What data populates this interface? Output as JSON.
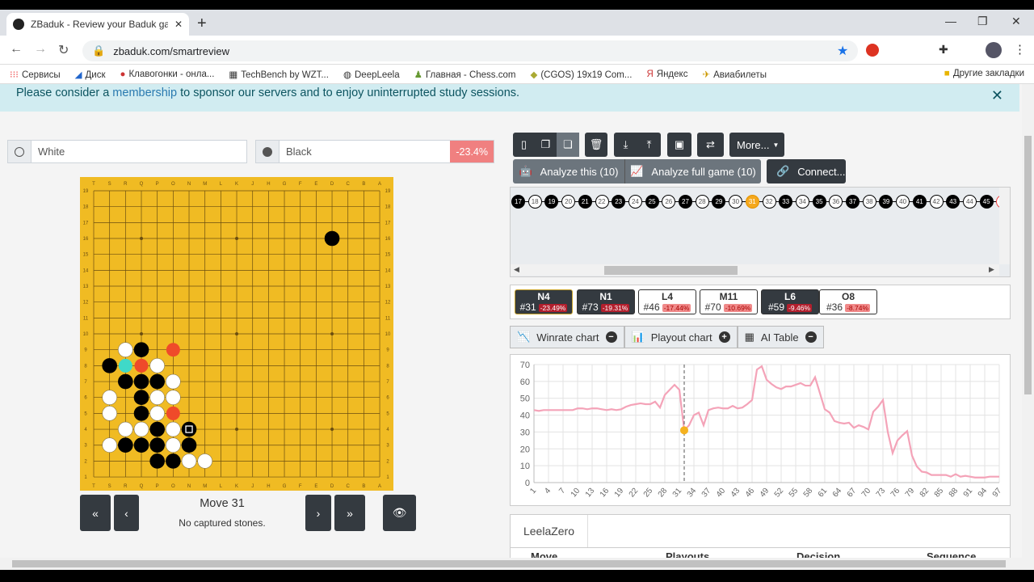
{
  "browser": {
    "tab_title": "ZBaduk - Review your Baduk gam",
    "url": "zbaduk.com/smartreview",
    "bookmarks": [
      "Сервисы",
      "Диск",
      "Клавогонки - онла...",
      "TechBench by WZT...",
      "DeepLeela",
      "Главная - Chess.com",
      "(CGOS) 19x19 Com...",
      "Яндекс",
      "Авиабилеты"
    ],
    "other_bookmarks": "Другие закладки"
  },
  "banner": {
    "before": "Please consider a ",
    "link": "membership",
    "after": " to sponsor our servers and to enjoy uninterrupted study sessions."
  },
  "players": {
    "white": "White",
    "black": "Black",
    "score": "-23.4%"
  },
  "board": {
    "columns": [
      "T",
      "S",
      "R",
      "Q",
      "P",
      "O",
      "N",
      "M",
      "L",
      "K",
      "J",
      "H",
      "G",
      "F",
      "E",
      "D",
      "C",
      "B",
      "A"
    ],
    "stones": [
      {
        "c": "D16",
        "color": "black"
      },
      {
        "c": "R9",
        "color": "white"
      },
      {
        "c": "Q9",
        "color": "black"
      },
      {
        "c": "S8",
        "color": "black"
      },
      {
        "c": "P8",
        "color": "white"
      },
      {
        "c": "R7",
        "color": "black"
      },
      {
        "c": "Q7",
        "color": "black"
      },
      {
        "c": "P7",
        "color": "black"
      },
      {
        "c": "O7",
        "color": "white"
      },
      {
        "c": "S6",
        "color": "white"
      },
      {
        "c": "Q6",
        "color": "black"
      },
      {
        "c": "P6",
        "color": "white"
      },
      {
        "c": "O6",
        "color": "white"
      },
      {
        "c": "S5",
        "color": "white"
      },
      {
        "c": "Q5",
        "color": "black"
      },
      {
        "c": "P5",
        "color": "white"
      },
      {
        "c": "R4",
        "color": "white"
      },
      {
        "c": "Q4",
        "color": "white"
      },
      {
        "c": "P4",
        "color": "black"
      },
      {
        "c": "O4",
        "color": "white"
      },
      {
        "c": "N4",
        "color": "black",
        "last": true
      },
      {
        "c": "S3",
        "color": "white"
      },
      {
        "c": "R3",
        "color": "black"
      },
      {
        "c": "Q3",
        "color": "black"
      },
      {
        "c": "P3",
        "color": "black"
      },
      {
        "c": "O3",
        "color": "white"
      },
      {
        "c": "N3",
        "color": "black"
      },
      {
        "c": "P2",
        "color": "black"
      },
      {
        "c": "O2",
        "color": "black"
      },
      {
        "c": "N2",
        "color": "white"
      },
      {
        "c": "M2",
        "color": "white"
      }
    ],
    "suggestions": [
      {
        "c": "R8",
        "color": "#3fd9c8"
      },
      {
        "c": "Q8",
        "color": "#ef4a2a"
      },
      {
        "c": "O9",
        "color": "#ef4a2a"
      },
      {
        "c": "O5",
        "color": "#ef4a2a"
      }
    ]
  },
  "nav": {
    "move": "Move 31",
    "captured": "No captured stones."
  },
  "toolbar": {
    "more": "More...",
    "analyze_this": "Analyze this (10)",
    "analyze_full": "Analyze full game (10)",
    "connect": "Connect..."
  },
  "movelist": {
    "first": 17,
    "last": 46,
    "current": 31
  },
  "mistakes": [
    {
      "move": "N4",
      "num": "#31",
      "pct": "-23.49%",
      "dark": true
    },
    {
      "move": "N1",
      "num": "#73",
      "pct": "-19.31%",
      "dark": true
    },
    {
      "move": "L4",
      "num": "#46",
      "pct": "-17.44%",
      "dark": false
    },
    {
      "move": "M11",
      "num": "#70",
      "pct": "-10.69%",
      "dark": false
    },
    {
      "move": "L6",
      "num": "#59",
      "pct": "-9.46%",
      "dark": true
    },
    {
      "move": "O8",
      "num": "#36",
      "pct": "-8.74%",
      "dark": false
    }
  ],
  "charttabs": [
    {
      "label": "Winrate chart",
      "toggle": "minus"
    },
    {
      "label": "Playout chart",
      "toggle": "plus"
    },
    {
      "label": "AI Table",
      "toggle": "minus"
    }
  ],
  "engine": {
    "tab": "LeelaZero",
    "columns": [
      "Move",
      "Playouts",
      "Decision",
      "Sequence"
    ]
  },
  "chart_data": {
    "type": "line",
    "ylim": [
      0,
      70
    ],
    "yticks": [
      0,
      10,
      20,
      30,
      40,
      50,
      60,
      70
    ],
    "xticks": [
      1,
      4,
      7,
      10,
      13,
      16,
      19,
      22,
      25,
      28,
      31,
      34,
      37,
      40,
      43,
      46,
      49,
      52,
      55,
      58,
      61,
      64,
      67,
      70,
      73,
      76,
      79,
      82,
      85,
      88,
      91,
      94,
      97
    ],
    "x_start": 1,
    "highlight_x": 32,
    "grid": true,
    "line_color": "#f4a3b8",
    "marker_color": "#f5b21f",
    "values": [
      43,
      42.5,
      43,
      43,
      43,
      43,
      43,
      43,
      43,
      44,
      44,
      43.5,
      44,
      44,
      43.5,
      43,
      43.5,
      43,
      43.5,
      45,
      46,
      46.5,
      47,
      46.5,
      46.5,
      48,
      44.5,
      52,
      55,
      58,
      55,
      31,
      34,
      40,
      41.5,
      34,
      43,
      44,
      44.5,
      44,
      44,
      45.5,
      44,
      44.5,
      46.5,
      49,
      67,
      69,
      61,
      58.5,
      56.5,
      55.5,
      57,
      57,
      58,
      59,
      57.5,
      57.5,
      62.5,
      53,
      43.5,
      41.5,
      36.5,
      35.5,
      35,
      35.5,
      32.5,
      34,
      33,
      31.5,
      42,
      45,
      49,
      30,
      17.5,
      25,
      28,
      30.5,
      16,
      9.5,
      6.5,
      6,
      4.5,
      4.5,
      4.5,
      4.5,
      3.5,
      5,
      3.5,
      4,
      3.5,
      3,
      3,
      3,
      3.5,
      3.5,
      3.5
    ]
  }
}
